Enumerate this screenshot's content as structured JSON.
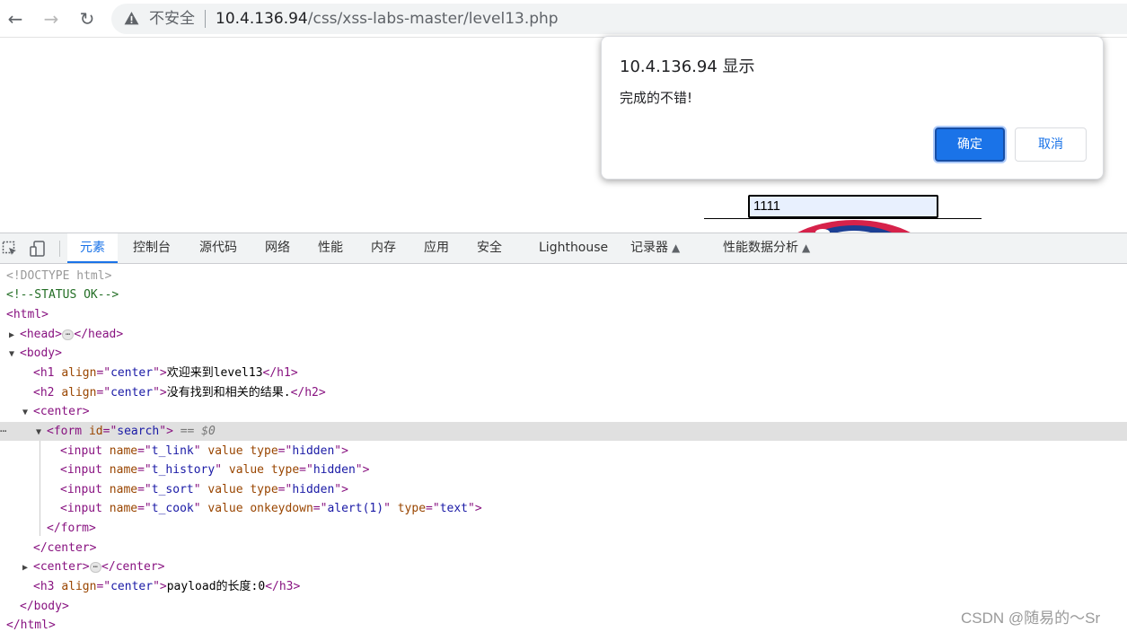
{
  "browser": {
    "security_label": "不安全",
    "url_host": "10.4.136.94",
    "url_path": "/css/xss-labs-master/level13.php"
  },
  "page": {
    "input_value": "1111"
  },
  "dialog": {
    "title": "10.4.136.94 显示",
    "message": "完成的不错!",
    "ok_label": "确定",
    "cancel_label": "取消"
  },
  "devtools": {
    "tabs": [
      "元素",
      "控制台",
      "源代码",
      "网络",
      "性能",
      "内存",
      "应用",
      "安全",
      "Lighthouse",
      "记录器",
      "性能数据分析"
    ]
  },
  "dom": {
    "doctype": "<!DOCTYPE html>",
    "comment": "<!--STATUS OK-->",
    "h1_text": "欢迎来到level13",
    "h2_text": "没有找到和相关的结果.",
    "h3_text": "payload的长度:0",
    "selected_marker": "== $0"
  },
  "watermark": "CSDN @随易的～Sr",
  "colors": {
    "accent": "#1a73e8",
    "tag": "#881280",
    "attr_name": "#994500",
    "attr_value": "#1a1aa6"
  }
}
